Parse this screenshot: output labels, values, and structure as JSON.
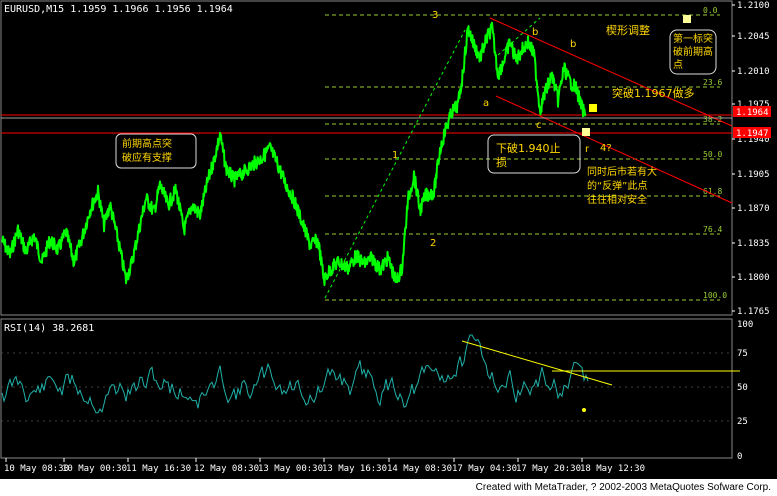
{
  "header": {
    "title": "EURUSD,M15  1.1959 1.1966 1.1956 1.1964"
  },
  "rsi_header": {
    "title": "RSI(14) 38.2681"
  },
  "footer": {
    "credit": "Created with MetaTrader, ? 2002-2003 MetaQuotes Sofware Corp."
  },
  "colors": {
    "price": "#00ff00",
    "rsi": "#20b2aa",
    "fib": "#9acd32",
    "annot": "#ffd700",
    "channel": "#ff0000",
    "trend": "#ffff00"
  },
  "price_axis": {
    "ticks": [
      "1.2100",
      "1.2045",
      "1.2010",
      "1.1975",
      "1.1940",
      "1.1905",
      "1.1870",
      "1.1835",
      "1.1800",
      "1.1765"
    ],
    "current_label": "1.1964",
    "marker_label": "1.1947"
  },
  "rsi_axis": {
    "ticks": [
      "100",
      "75",
      "50",
      "25",
      "0"
    ]
  },
  "time_axis": {
    "ticks": [
      "10 May 08:30",
      "10 May 00:30",
      "11 May 16:30",
      "12 May 08:30",
      "13 May 00:30",
      "13 May 16:30",
      "14 May 08:30",
      "17 May 04:30",
      "17 May 20:30",
      "18 May 12:30"
    ]
  },
  "fib_levels": {
    "labels": [
      "0.0",
      "23.6",
      "38.2",
      "50.0",
      "61.8",
      "76.4",
      "100.0"
    ]
  },
  "annotations": {
    "wedge": "楔形调整",
    "target_1": "第一标突",
    "target_2": "破前期高",
    "target_3": "点",
    "break_buy": "突破1.1967做多",
    "prev_high_1": "前期高点突",
    "prev_high_2": "破应有支撑",
    "stop_1": "下破1.940止",
    "stop_2": "损",
    "note_1": "同时后市若有大",
    "note_2": "的“反弹”此点",
    "note_3": "往往相对安全",
    "wave_3": "3",
    "wave_1": "1",
    "wave_2": "2",
    "wave_a": "a",
    "wave_b1": "b",
    "wave_b2": "b",
    "wave_c": "c",
    "wave_r": "r",
    "wave_4": "4?"
  },
  "chart_data": [
    {
      "type": "line",
      "series": [
        {
          "name": "EURUSD,M15",
          "y_range_note": "close prices"
        }
      ],
      "ylim": [
        1.175,
        1.211
      ],
      "fib_retracement": {
        "high": 1.2095,
        "low": 1.1776,
        "levels": [
          0.0,
          23.6,
          38.2,
          50.0,
          61.8,
          76.4,
          100.0
        ]
      },
      "horizontal_levels": [
        1.1964,
        1.1947
      ],
      "key_prices": {
        "break_long": 1.1967,
        "stop": 1.194
      }
    },
    {
      "type": "line",
      "series": [
        {
          "name": "RSI(14)",
          "last": 38.2681
        }
      ],
      "ylim": [
        0,
        100
      ],
      "levels": [
        75,
        50,
        25
      ]
    }
  ]
}
